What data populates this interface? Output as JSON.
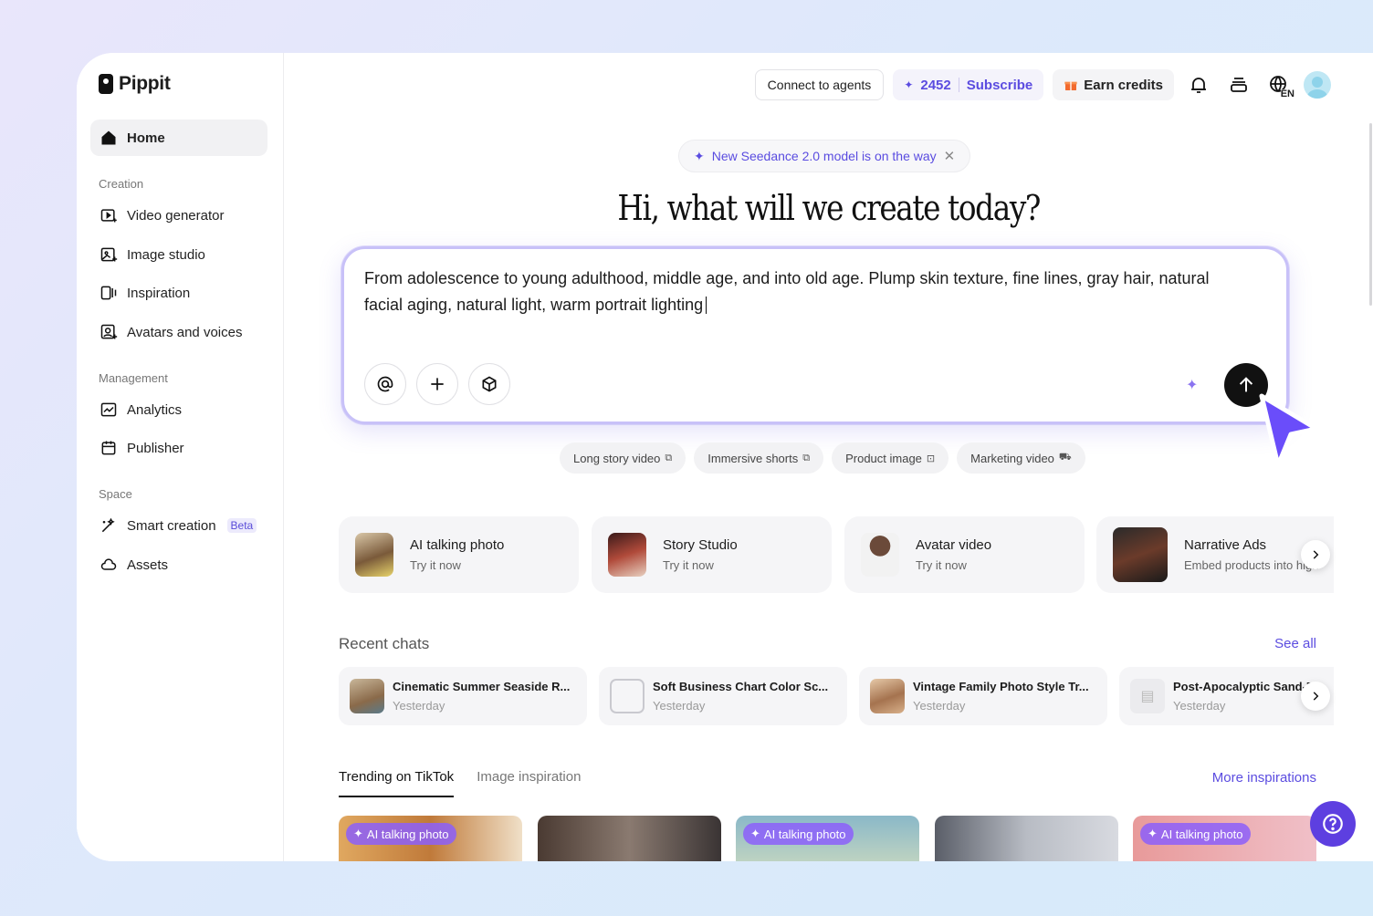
{
  "app": {
    "name": "Pippit"
  },
  "sidebar": {
    "home": "Home",
    "sections": [
      {
        "label": "Creation",
        "items": [
          "Video generator",
          "Image studio",
          "Inspiration",
          "Avatars and voices"
        ]
      },
      {
        "label": "Management",
        "items": [
          "Analytics",
          "Publisher"
        ]
      },
      {
        "label": "Space",
        "items": [
          "Smart creation",
          "Assets"
        ]
      }
    ],
    "beta_badge": "Beta"
  },
  "topbar": {
    "connect": "Connect to agents",
    "credits": "2452",
    "subscribe": "Subscribe",
    "earn": "Earn credits",
    "language": "EN"
  },
  "announcement": {
    "text": "New Seedance 2.0 model is on the way"
  },
  "headline": "Hi, what will we create today?",
  "prompt": {
    "value": "From adolescence to young adulthood, middle age, and into old age. Plump skin texture, fine lines, gray hair, natural facial aging, natural light, warm portrait lighting"
  },
  "quick_chips": [
    {
      "label": "Long story video",
      "icon": "video-icon"
    },
    {
      "label": "Immersive shorts",
      "icon": "shorts-icon"
    },
    {
      "label": "Product image",
      "icon": "image-icon"
    },
    {
      "label": "Marketing video",
      "icon": "cart-icon"
    }
  ],
  "features": [
    {
      "title": "AI talking photo",
      "sub": "Try it now"
    },
    {
      "title": "Story Studio",
      "sub": "Try it now"
    },
    {
      "title": "Avatar video",
      "sub": "Try it now"
    },
    {
      "title": "Narrative Ads",
      "sub": "Embed products into high"
    }
  ],
  "recent": {
    "title": "Recent chats",
    "see_all": "See all",
    "chats": [
      {
        "title": "Cinematic Summer Seaside R...",
        "time": "Yesterday"
      },
      {
        "title": "Soft Business Chart Color Sc...",
        "time": "Yesterday"
      },
      {
        "title": "Vintage Family Photo Style Tr...",
        "time": "Yesterday"
      },
      {
        "title": "Post-Apocalyptic Sand-F",
        "time": "Yesterday"
      }
    ]
  },
  "inspiration": {
    "tabs": [
      "Trending on TikTok",
      "Image inspiration"
    ],
    "more": "More inspirations",
    "badge": "AI talking photo"
  },
  "colors": {
    "accent": "#5b4ce0",
    "help": "#5d3fe0"
  }
}
